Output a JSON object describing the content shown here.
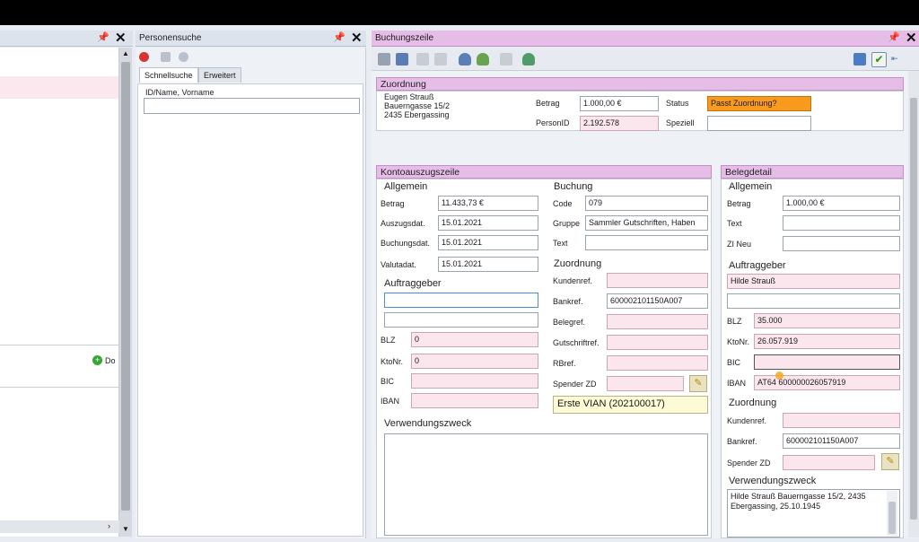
{
  "left_panel": {
    "link_text": "Do"
  },
  "personensuche": {
    "title": "Personensuche",
    "tabs": [
      "Schnellsuche",
      "Erweitert"
    ],
    "field_label": "ID/Name, Vorname",
    "field_value": ""
  },
  "buchungszeile": {
    "title": "Buchungszeile",
    "zuordnung": {
      "header": "Zuordnung",
      "address": [
        "Eugen Strauß",
        "Bauerngasse 15/2",
        "2435 Ebergassing"
      ],
      "betrag_label": "Betrag",
      "betrag": "1.000,00 €",
      "status_label": "Status",
      "status": "Passt Zuordnung?",
      "personid_label": "PersonID",
      "personid": "2.192.578",
      "speziell_label": "Speziell",
      "speziell": ""
    },
    "konto": {
      "header": "Kontoauszugszeile",
      "allgemein": {
        "title": "Allgemein",
        "betrag_label": "Betrag",
        "betrag": "11.433,73 €",
        "auszugsdat_label": "Auszugsdat.",
        "auszugsdat": "15.01.2021",
        "buchungsdat_label": "Buchungsdat.",
        "buchungsdat": "15.01.2021",
        "valutadat_label": "Valutadat.",
        "valutadat": "15.01.2021"
      },
      "buchung": {
        "title": "Buchung",
        "code_label": "Code",
        "code": "079",
        "gruppe_label": "Gruppe",
        "gruppe": "Sammler Gutschriften, Haben",
        "text_label": "Text",
        "text": ""
      },
      "auftraggeber": {
        "title": "Auftraggeber",
        "blz_label": "BLZ",
        "blz": "0",
        "ktonr_label": "KtoNr.",
        "ktonr": "0",
        "bic_label": "BIC",
        "bic": "",
        "iban_label": "IBAN",
        "iban": ""
      },
      "zuordnung": {
        "title": "Zuordnung",
        "kundenref_label": "Kundenref.",
        "kundenref": "",
        "bankref_label": "Bankref.",
        "bankref": "600002101150A007",
        "belegref_label": "Belegref.",
        "belegref": "",
        "gutschriftref_label": "Gutschriftref.",
        "gutschriftref": "",
        "rbref_label": "RBref.",
        "rbref": "",
        "spender_label": "Spender ZD",
        "spender": "",
        "vian": "Erste VIAN (202100017)"
      },
      "verwendungszweck": {
        "title": "Verwendungszweck",
        "text": ""
      }
    },
    "beleg": {
      "header": "Belegdetail",
      "allgemein": {
        "title": "Allgemein",
        "betrag_label": "Betrag",
        "betrag": "1.000,00 €",
        "text_label": "Text",
        "text": "",
        "zineu_label": "ZI Neu",
        "zineu": ""
      },
      "auftraggeber": {
        "title": "Auftraggeber",
        "name1": "Hilde Strauß",
        "name2": "",
        "blz_label": "BLZ",
        "blz": "35.000",
        "ktonr_label": "KtoNr.",
        "ktonr": "26.057.919",
        "bic_label": "BIC",
        "bic": "",
        "iban_label": "IBAN",
        "iban": "AT64 600000026057919"
      },
      "zuordnung": {
        "title": "Zuordnung",
        "kundenref_label": "Kundenref.",
        "kundenref": "",
        "bankref_label": "Bankref.",
        "bankref": "600002101150A007",
        "spender_label": "Spender ZD",
        "spender": ""
      },
      "verwendungszweck": {
        "title": "Verwendungszweck",
        "text": "Hilde Strauß Bauerngasse 15/2, 2435 Ebergassing, 25.10.1945"
      }
    }
  },
  "colors": {
    "section_bar": "#e6bde6",
    "pink_field": "#fbe6ee",
    "status_orange": "#f79a1e",
    "vian_yellow": "#fdfbd6"
  },
  "icons": [
    "pin-icon",
    "close-icon",
    "stop-icon",
    "search-icon",
    "person-icon",
    "save-icon",
    "check-icon",
    "pencil-icon"
  ]
}
